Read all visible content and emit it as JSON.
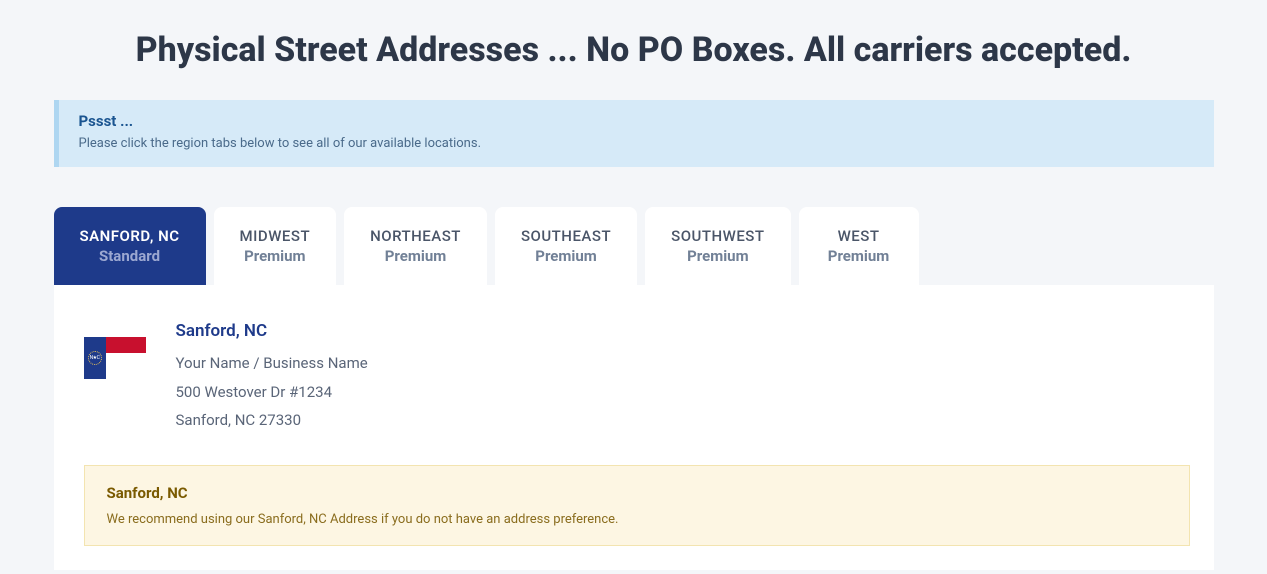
{
  "page_title": "Physical Street Addresses ... No PO Boxes. All carriers accepted.",
  "info": {
    "title": "Pssst ...",
    "text": "Please click the region tabs below to see all of our available locations."
  },
  "tabs": [
    {
      "region": "SANFORD, NC",
      "tier": "Standard",
      "active": true
    },
    {
      "region": "MIDWEST",
      "tier": "Premium",
      "active": false
    },
    {
      "region": "NORTHEAST",
      "tier": "Premium",
      "active": false
    },
    {
      "region": "SOUTHEAST",
      "tier": "Premium",
      "active": false
    },
    {
      "region": "SOUTHWEST",
      "tier": "Premium",
      "active": false
    },
    {
      "region": "WEST",
      "tier": "Premium",
      "active": false
    }
  ],
  "address": {
    "title": "Sanford, NC",
    "name_line": "Your Name / Business Name",
    "street": "500 Westover Dr #1234",
    "citystate": "Sanford, NC 27330"
  },
  "note": {
    "title": "Sanford, NC",
    "text": "We recommend using our Sanford, NC Address if you do not have an address preference."
  }
}
